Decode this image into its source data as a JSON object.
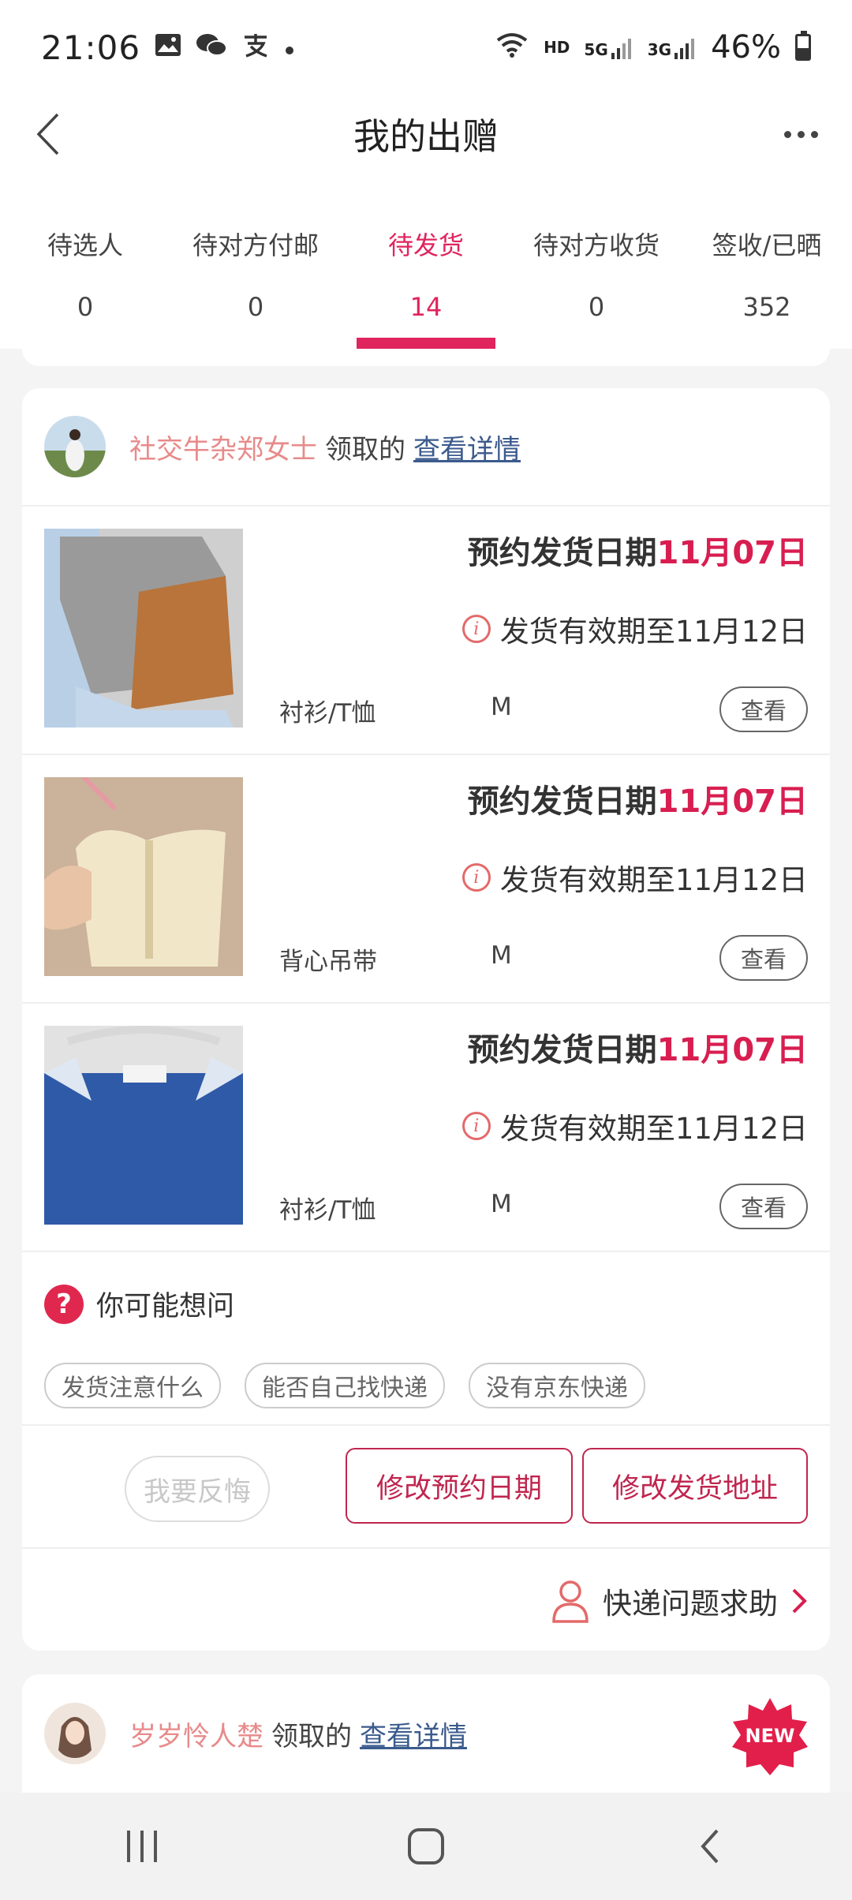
{
  "status_bar": {
    "time": "21:06",
    "left_icons": [
      "image-icon",
      "wechat-icon",
      "alipay-icon",
      "dot-icon"
    ],
    "hd": "HD",
    "net_5g": "5G",
    "net_3g": "3G",
    "battery": "46%",
    "battery_level": 0.46
  },
  "nav": {
    "title": "我的出赠"
  },
  "tabs": [
    {
      "label": "待选人",
      "count": "0",
      "active": false
    },
    {
      "label": "待对方付邮",
      "count": "0",
      "active": false
    },
    {
      "label": "待发货",
      "count": "14",
      "active": true
    },
    {
      "label": "待对方收货",
      "count": "0",
      "active": false
    },
    {
      "label": "签收/已晒",
      "count": "352",
      "active": false
    }
  ],
  "accent_color": "#e0245e",
  "order": {
    "receiver_name": "社交牛杂郑女士",
    "received_text": "领取的",
    "detail_link": "查看详情",
    "items": [
      {
        "date_label": "预约发货日期",
        "date_value": "11月07日",
        "validity": "发货有效期至11月12日",
        "category": "衬衫/T恤",
        "size": "M",
        "view_label": "查看"
      },
      {
        "date_label": "预约发货日期",
        "date_value": "11月07日",
        "validity": "发货有效期至11月12日",
        "category": "背心吊带",
        "size": "M",
        "view_label": "查看"
      },
      {
        "date_label": "预约发货日期",
        "date_value": "11月07日",
        "validity": "发货有效期至11月12日",
        "category": "衬衫/T恤",
        "size": "M",
        "view_label": "查看"
      }
    ],
    "faq": {
      "title": "你可能想问",
      "chips": [
        "发货注意什么",
        "能否自己找快递",
        "没有京东快递"
      ]
    },
    "actions": {
      "regret": "我要反悔",
      "change_date": "修改预约日期",
      "change_address": "修改发货地址"
    },
    "help": "快递问题求助"
  },
  "next_order": {
    "receiver_name": "岁岁怜人楚",
    "received_text": "领取的",
    "detail_link": "查看详情",
    "badge": "NEW"
  }
}
